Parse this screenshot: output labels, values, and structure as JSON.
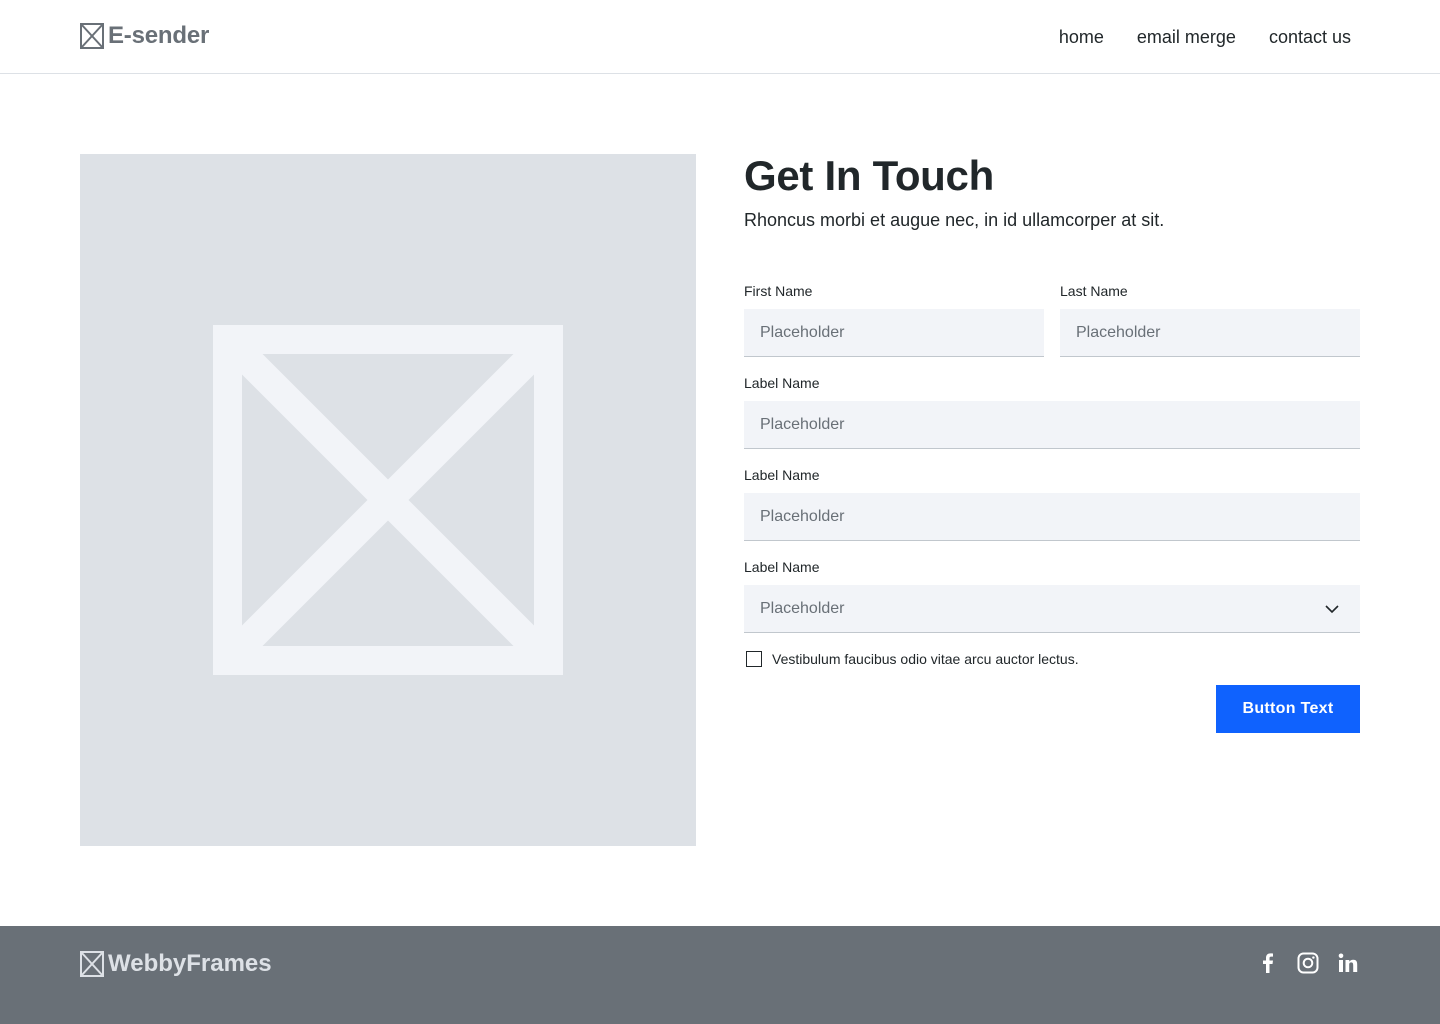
{
  "header": {
    "logo_text": "E-sender",
    "nav": [
      "home",
      "email merge",
      "contact us"
    ]
  },
  "hero_image": {
    "icon": "image-placeholder-icon"
  },
  "form": {
    "title": "Get In Touch",
    "subtitle": "Rhoncus morbi et augue nec, in id ullamcorper at sit.",
    "first_name": {
      "label": "First Name",
      "placeholder": "Placeholder"
    },
    "last_name": {
      "label": "Last Name",
      "placeholder": "Placeholder"
    },
    "field1": {
      "label": "Label Name",
      "placeholder": "Placeholder"
    },
    "field2": {
      "label": "Label Name",
      "placeholder": "Placeholder"
    },
    "select": {
      "label": "Label Name",
      "value": "Placeholder"
    },
    "checkbox_label": "Vestibulum faucibus odio vitae arcu auctor lectus.",
    "submit_label": "Button Text"
  },
  "footer": {
    "logo_text": "WebbyFrames",
    "social": [
      "facebook-icon",
      "instagram-icon",
      "linkedin-icon"
    ]
  },
  "colors": {
    "primary": "#0f62fe",
    "field_bg": "#f2f4f8",
    "placeholder_bg": "#dde1e6",
    "footer_bg": "#697077",
    "text": "#21272a"
  }
}
